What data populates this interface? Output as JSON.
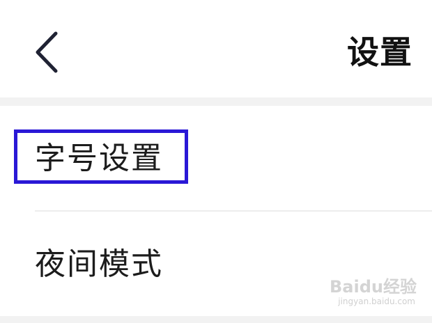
{
  "header": {
    "back_icon": "chevron-left-icon",
    "title": "设置"
  },
  "settings": {
    "items": [
      {
        "label": "字号设置",
        "highlighted": true
      },
      {
        "label": "夜间模式",
        "highlighted": false
      }
    ]
  },
  "watermark": {
    "logo": "Baidu经验",
    "url": "jingyan.baidu.com"
  },
  "colors": {
    "highlight_border": "#2a18d6",
    "background": "#f2f2f2",
    "surface": "#ffffff",
    "text": "#1c1c1c"
  }
}
